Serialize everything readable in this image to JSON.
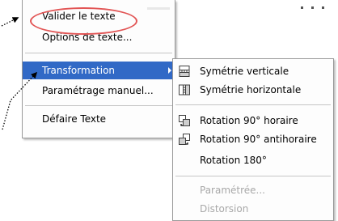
{
  "main_menu": {
    "items": [
      {
        "label": "Valider le texte"
      },
      {
        "label": "Options de texte..."
      },
      {
        "label": "Transformation"
      },
      {
        "label": "Paramétrage manuel..."
      },
      {
        "label": "Défaire Texte"
      }
    ],
    "highlight_color": "#3169c6"
  },
  "submenu": {
    "items": [
      {
        "label": "Symétrie verticale",
        "icon": "flip-vertical-icon"
      },
      {
        "label": "Symétrie horizontale",
        "icon": "flip-horizontal-icon"
      },
      {
        "label": "Rotation 90° horaire",
        "icon": "rotate-clockwise-icon"
      },
      {
        "label": "Rotation 90° antihoraire",
        "icon": "rotate-counterclockwise-icon"
      },
      {
        "label": "Rotation 180°"
      },
      {
        "label": "Paramétrée...",
        "disabled": true
      },
      {
        "label": "Distorsion",
        "disabled": true
      }
    ]
  },
  "annotation": {
    "ellipse_color": "#e25555",
    "arrow_color": "#000000"
  }
}
